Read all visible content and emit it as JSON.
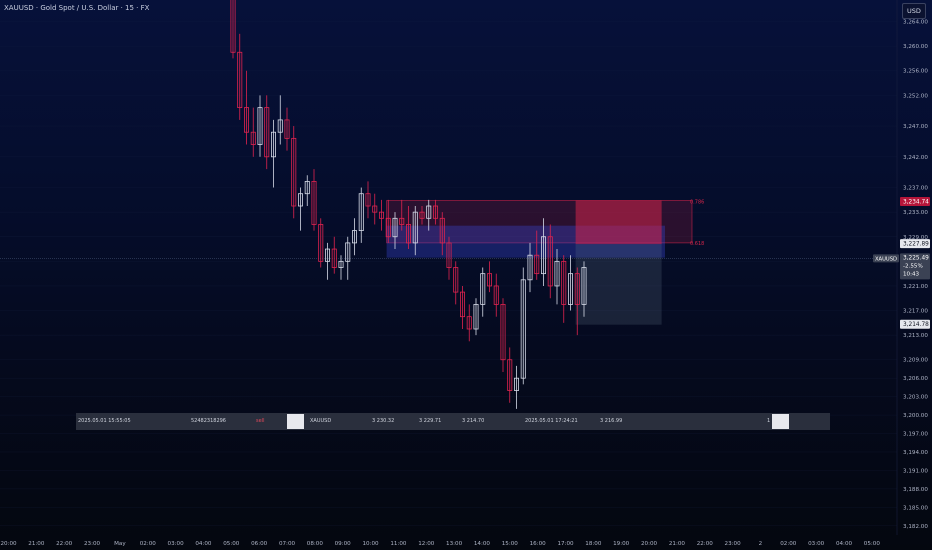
{
  "header": {
    "title": "XAUUSD · Gold Spot / U.S. Dollar · 15 · FX",
    "currency_button": "USD"
  },
  "chart_data": {
    "type": "candlestick",
    "title": "XAUUSD · Gold Spot / U.S. Dollar · 15 · FX",
    "symbol": "XAUUSD",
    "interval": "15",
    "currency": "USD",
    "ylim": [
      3180.5,
      3267.5
    ],
    "y_ticks": [
      "3,264.00",
      "3,260.00",
      "3,256.00",
      "3,252.00",
      "3,247.00",
      "3,242.00",
      "3,237.00",
      "3,233.00",
      "3,229.00",
      "3,225.00",
      "3,221.00",
      "3,217.00",
      "3,213.00",
      "3,209.00",
      "3,206.00",
      "3,203.00",
      "3,200.00",
      "3,197.00",
      "3,194.00",
      "3,191.00",
      "3,188.00",
      "3,185.00",
      "3,182.00"
    ],
    "x_ticks": [
      "20:00",
      "21:00",
      "22:00",
      "23:00",
      "May",
      "02:00",
      "03:00",
      "04:00",
      "05:00",
      "06:00",
      "07:00",
      "08:00",
      "09:00",
      "10:00",
      "11:00",
      "12:00",
      "13:00",
      "14:00",
      "15:00",
      "16:00",
      "17:00",
      "18:00",
      "19:00",
      "20:00",
      "21:00",
      "22:00",
      "23:00",
      "2",
      "02:00",
      "03:00",
      "04:00",
      "05:00"
    ],
    "candles": [
      [
        3272,
        3274,
        3258,
        3259
      ],
      [
        3259,
        3262,
        3248,
        3250
      ],
      [
        3250,
        3256,
        3244,
        3246
      ],
      [
        3246,
        3250,
        3242,
        3244
      ],
      [
        3244,
        3252,
        3242,
        3250
      ],
      [
        3250,
        3252,
        3240,
        3242
      ],
      [
        3242,
        3248,
        3237,
        3246
      ],
      [
        3246,
        3252,
        3244,
        3248
      ],
      [
        3248,
        3250,
        3243,
        3245
      ],
      [
        3245,
        3247,
        3232,
        3234
      ],
      [
        3234,
        3237,
        3230,
        3236
      ],
      [
        3236,
        3239,
        3234,
        3238
      ],
      [
        3238,
        3240,
        3230,
        3231
      ],
      [
        3231,
        3232,
        3224,
        3225
      ],
      [
        3225,
        3228,
        3222,
        3227
      ],
      [
        3227,
        3229,
        3223,
        3224
      ],
      [
        3224,
        3226,
        3222,
        3225
      ],
      [
        3225,
        3229,
        3222,
        3228
      ],
      [
        3228,
        3232,
        3226,
        3230
      ],
      [
        3230,
        3237,
        3228,
        3236
      ],
      [
        3236,
        3238,
        3232,
        3234
      ],
      [
        3234,
        3236,
        3231,
        3233
      ],
      [
        3233,
        3235,
        3230,
        3232
      ],
      [
        3232,
        3235,
        3228,
        3229
      ],
      [
        3229,
        3233,
        3227,
        3232
      ],
      [
        3232,
        3235,
        3230,
        3231
      ],
      [
        3231,
        3234,
        3227,
        3228
      ],
      [
        3228,
        3234,
        3226,
        3233
      ],
      [
        3233,
        3234,
        3231,
        3232
      ],
      [
        3232,
        3235,
        3230,
        3234
      ],
      [
        3234,
        3235,
        3231,
        3232
      ],
      [
        3232,
        3233,
        3226,
        3228
      ],
      [
        3228,
        3229,
        3222,
        3224
      ],
      [
        3224,
        3225,
        3218,
        3220
      ],
      [
        3220,
        3221,
        3214,
        3216
      ],
      [
        3216,
        3218,
        3212,
        3214
      ],
      [
        3214,
        3219,
        3213,
        3218
      ],
      [
        3218,
        3224,
        3216,
        3223
      ],
      [
        3223,
        3225,
        3220,
        3221
      ],
      [
        3221,
        3223,
        3216,
        3218
      ],
      [
        3218,
        3219,
        3207,
        3209
      ],
      [
        3209,
        3211,
        3202,
        3204
      ],
      [
        3204,
        3208,
        3201,
        3206
      ],
      [
        3206,
        3224,
        3205,
        3222
      ],
      [
        3222,
        3228,
        3220,
        3226
      ],
      [
        3226,
        3230,
        3222,
        3223
      ],
      [
        3223,
        3232,
        3221,
        3229
      ],
      [
        3229,
        3231,
        3219,
        3221
      ],
      [
        3221,
        3227,
        3218,
        3225
      ],
      [
        3225,
        3226,
        3215,
        3218
      ],
      [
        3218,
        3226,
        3217,
        3223
      ],
      [
        3223,
        3224,
        3213,
        3218
      ],
      [
        3218,
        3225,
        3216,
        3224
      ]
    ],
    "zones": [
      {
        "type": "resistance",
        "from": 3228.0,
        "to": 3234.9,
        "label": "0.786"
      },
      {
        "type": "demand",
        "from": 3225.6,
        "to": 3230.8
      },
      {
        "type": "position-stop",
        "from": 3227.8,
        "to": 3234.9
      },
      {
        "type": "position-target",
        "from": 3214.7,
        "to": 3227.8
      }
    ],
    "zone_labels": {
      "upper": "0.786",
      "lower": "0.618"
    },
    "price_tags": [
      {
        "value": "3,234.74",
        "color": "#b5153a",
        "text_color": "#ffffff"
      },
      {
        "value": "3,227.89",
        "color": "#e6e8ee",
        "text_color": "#121622"
      },
      {
        "value": "3,214.78",
        "color": "#e6e8ee",
        "text_color": "#121622"
      }
    ],
    "last_price": {
      "symbol": "XAUUSD",
      "value": "3,225.49",
      "change": "-2.55%",
      "countdown": "10:43",
      "level": 3225.49
    }
  },
  "trade_bar": {
    "open_time": "2025.05.01 15:55:05",
    "ticket": "52482318296",
    "side": "sell",
    "symbol": "XAUUSD",
    "open_price": "3 230.32",
    "sl": "3 229.71",
    "tp": "3 214.70",
    "close_time": "2025.05.01 17:24:21",
    "close_price": "3 216.99",
    "profit_prefix": "1"
  },
  "colors": {
    "up": "#d6dbe8",
    "down": "#e0234f",
    "resistance": "#d1254a",
    "demand": "#3a47d8",
    "target": "#6b7b8f",
    "grid": "#1a2444",
    "axis_text": "#aeb4c6"
  }
}
